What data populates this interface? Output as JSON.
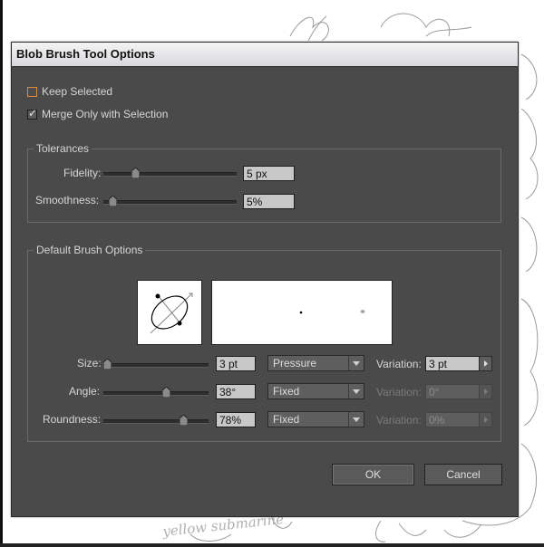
{
  "window": {
    "title": "Blob Brush Tool Options"
  },
  "options": {
    "keep_selected": {
      "label": "Keep Selected",
      "checked": false
    },
    "merge_only": {
      "label": "Merge Only with Selection",
      "checked": true
    }
  },
  "tolerances": {
    "legend": "Tolerances",
    "fidelity": {
      "label": "Fidelity:",
      "value": "5 px",
      "slider_fraction": 0.25
    },
    "smoothness": {
      "label": "Smoothness:",
      "value": "5%",
      "slider_fraction": 0.05
    }
  },
  "brush": {
    "legend": "Default Brush Options",
    "size": {
      "label": "Size:",
      "value": "3 pt",
      "mode": "Pressure",
      "variation_label": "Variation:",
      "variation": "3 pt",
      "variation_enabled": true,
      "slider_fraction": 0.03
    },
    "angle": {
      "label": "Angle:",
      "value": "38°",
      "mode": "Fixed",
      "variation_label": "Variation:",
      "variation": "0°",
      "variation_enabled": false,
      "slider_fraction": 0.6
    },
    "roundness": {
      "label": "Roundness:",
      "value": "78%",
      "mode": "Fixed",
      "variation_label": "Variation:",
      "variation": "0%",
      "variation_enabled": false,
      "slider_fraction": 0.78
    }
  },
  "buttons": {
    "ok": "OK",
    "cancel": "Cancel"
  },
  "background_art": {
    "text": "yellow submarine"
  },
  "colors": {
    "dialog_bg": "#4a4a4a",
    "focus_outline": "#d98a3c",
    "field_bg": "#c8c8c8"
  }
}
